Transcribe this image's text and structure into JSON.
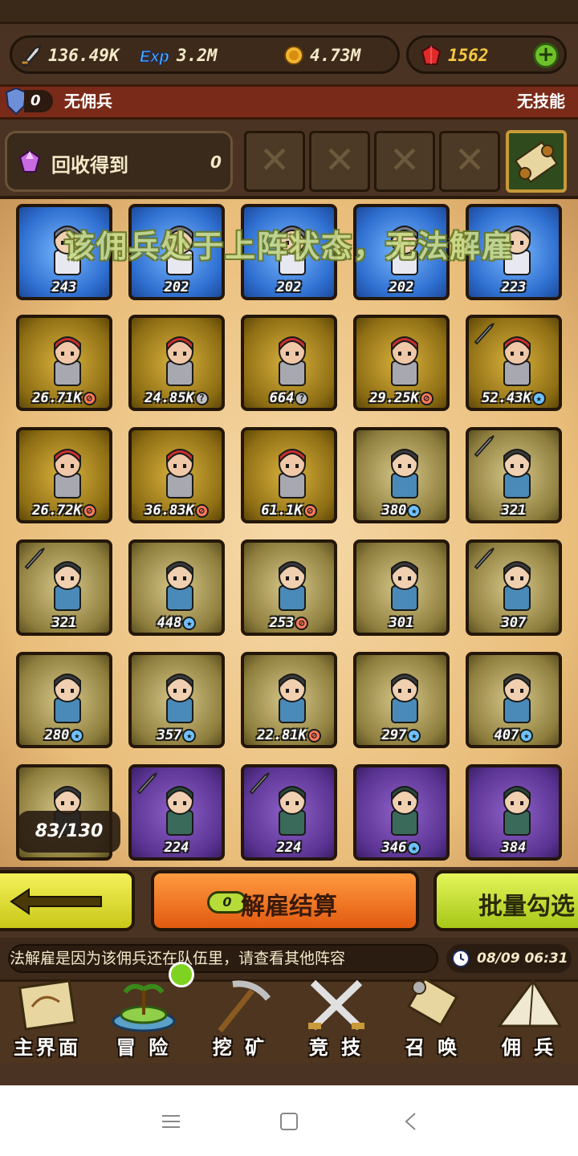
{
  "resources": {
    "attack": "136.49K",
    "exp": "3.2M",
    "gold": "4.73M",
    "gems": "1562"
  },
  "status": {
    "count": "0",
    "mercenary": "无佣兵",
    "skill": "无技能"
  },
  "recycle": {
    "label": "回收得到",
    "value": "0"
  },
  "banner": "该佣兵处于上阵状态，无法解雇",
  "counter": "83/130",
  "cards": [
    {
      "lv": "243",
      "b": "plus",
      "c": "blue"
    },
    {
      "lv": "202",
      "b": "plus",
      "c": "blue"
    },
    {
      "lv": "202",
      "b": "plus",
      "c": "blue"
    },
    {
      "lv": "202",
      "b": "plus",
      "c": "blue"
    },
    {
      "lv": "223",
      "b": "plus",
      "c": "blue"
    },
    {
      "lv": "26.71K",
      "b": "ban",
      "c": "gold"
    },
    {
      "lv": "24.85K",
      "b": "q",
      "c": "gold"
    },
    {
      "lv": "664",
      "b": "q",
      "c": "gold"
    },
    {
      "lv": "29.25K",
      "b": "ban",
      "c": "gold"
    },
    {
      "lv": "52.43K",
      "b": "star",
      "c": "gold",
      "sword": true
    },
    {
      "lv": "26.72K",
      "b": "ban",
      "c": "gold"
    },
    {
      "lv": "36.83K",
      "b": "ban",
      "c": "gold"
    },
    {
      "lv": "61.1K",
      "b": "ban",
      "c": "gold"
    },
    {
      "lv": "380",
      "b": "star",
      "c": "green"
    },
    {
      "lv": "321",
      "b": "plus",
      "c": "green",
      "sword": true
    },
    {
      "lv": "321",
      "b": "plus",
      "c": "green",
      "sword": true
    },
    {
      "lv": "448",
      "b": "star",
      "c": "green"
    },
    {
      "lv": "253",
      "b": "ban",
      "c": "green"
    },
    {
      "lv": "301",
      "b": "plus",
      "c": "green"
    },
    {
      "lv": "307",
      "b": "plus",
      "c": "green",
      "sword": true
    },
    {
      "lv": "280",
      "b": "star",
      "c": "green"
    },
    {
      "lv": "357",
      "b": "star",
      "c": "green"
    },
    {
      "lv": "22.81K",
      "b": "ban",
      "c": "green"
    },
    {
      "lv": "297",
      "b": "star",
      "c": "green"
    },
    {
      "lv": "407",
      "b": "star",
      "c": "green"
    },
    {
      "lv": "",
      "b": "",
      "c": "green"
    },
    {
      "lv": "224",
      "b": "plus",
      "c": "purple",
      "sword": true
    },
    {
      "lv": "224",
      "b": "plus",
      "c": "purple",
      "sword": true
    },
    {
      "lv": "346",
      "b": "star",
      "c": "purple"
    },
    {
      "lv": "384",
      "b": "plus",
      "c": "purple"
    }
  ],
  "buttons": {
    "settle_count": "0",
    "settle": "解雇结算",
    "batch": "批量勾选"
  },
  "message": "法解雇是因为该佣兵还在队伍里，请查看其他阵容",
  "time": "08/09 06:31",
  "nav": [
    "主界面",
    "冒 险",
    "挖 矿",
    "竞 技",
    "召 唤",
    "佣 兵"
  ],
  "colors": {
    "accent_gold": "#c89a38",
    "plus_green": "#6fc12a",
    "settle_orange": "#e25a10",
    "batch_green": "#a7c718"
  }
}
